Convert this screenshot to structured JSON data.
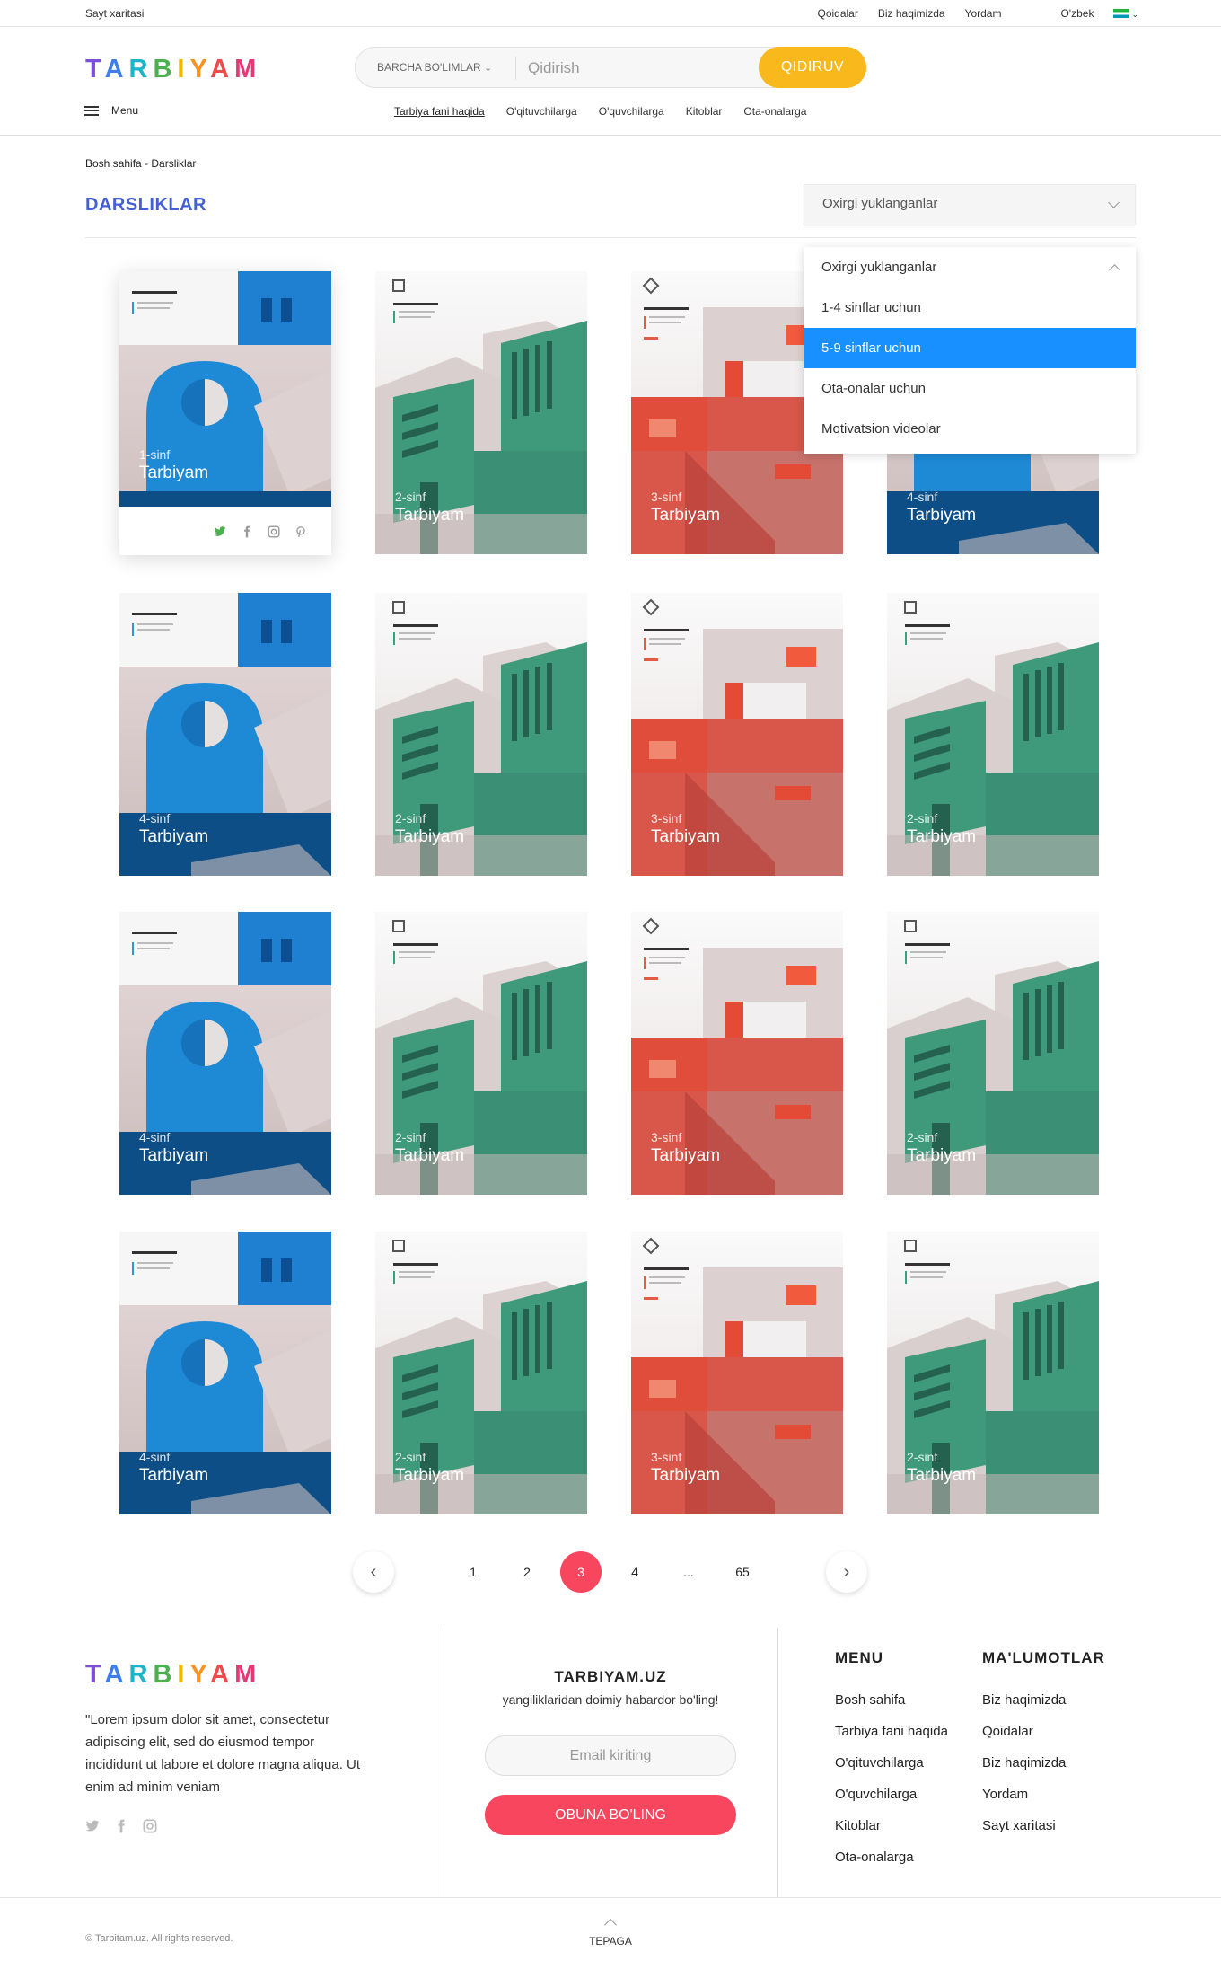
{
  "topbar": {
    "sitemap": "Sayt xaritasi",
    "links": [
      "Qoidalar",
      "Biz haqimizda",
      "Yordam"
    ],
    "language": "O'zbek"
  },
  "brand": {
    "logo_letters": [
      "T",
      "A",
      "R",
      "B",
      "I",
      "Y",
      "A",
      "M"
    ]
  },
  "search": {
    "category": "BARCHA BO'LIMLAR",
    "placeholder": "Qidirish",
    "button": "QIDIRUV"
  },
  "header": {
    "menu_label": "Menu",
    "nav": [
      "Tarbiya fani haqida",
      "O'qituvchilarga",
      "O'quvchilarga",
      "Kitoblar",
      "Ota-onalarga"
    ]
  },
  "page": {
    "breadcrumb": "Bosh sahifa - Darsliklar",
    "title": "DARSLIKLAR"
  },
  "sort": {
    "selected": "Oxirgi yuklanganlar",
    "options": [
      "Oxirgi yuklanganlar",
      "1-4 sinflar uchun",
      "5-9 sinflar uchun",
      "Ota-onalar uchun",
      "Motivatsion videolar"
    ],
    "highlighted": "5-9 sinflar uchun"
  },
  "cards": [
    {
      "grade": "1-sinf",
      "title": "Tarbiyam",
      "style": "blue"
    },
    {
      "grade": "2-sinf",
      "title": "Tarbiyam",
      "style": "green"
    },
    {
      "grade": "3-sinf",
      "title": "Tarbiyam",
      "style": "red"
    },
    {
      "grade": "4-sinf",
      "title": "Tarbiyam",
      "style": "blue"
    },
    {
      "grade": "4-sinf",
      "title": "Tarbiyam",
      "style": "blue"
    },
    {
      "grade": "2-sinf",
      "title": "Tarbiyam",
      "style": "green"
    },
    {
      "grade": "3-sinf",
      "title": "Tarbiyam",
      "style": "red"
    },
    {
      "grade": "2-sinf",
      "title": "Tarbiyam",
      "style": "green"
    },
    {
      "grade": "4-sinf",
      "title": "Tarbiyam",
      "style": "blue"
    },
    {
      "grade": "2-sinf",
      "title": "Tarbiyam",
      "style": "green"
    },
    {
      "grade": "3-sinf",
      "title": "Tarbiyam",
      "style": "red"
    },
    {
      "grade": "2-sinf",
      "title": "Tarbiyam",
      "style": "green"
    },
    {
      "grade": "4-sinf",
      "title": "Tarbiyam",
      "style": "blue"
    },
    {
      "grade": "2-sinf",
      "title": "Tarbiyam",
      "style": "green"
    },
    {
      "grade": "3-sinf",
      "title": "Tarbiyam",
      "style": "red"
    },
    {
      "grade": "2-sinf",
      "title": "Tarbiyam",
      "style": "green"
    }
  ],
  "pagination": {
    "pages": [
      "1",
      "2",
      "3",
      "4",
      "...",
      "65"
    ],
    "current": "3"
  },
  "footer": {
    "about": "\"Lorem ipsum dolor sit amet, consectetur adipiscing elit, sed do eiusmod tempor incididunt ut labore et dolore magna aliqua. Ut enim ad minim veniam",
    "newsletter_title": "TARBIYAM.UZ",
    "newsletter_text": "yangiliklaridan doimiy habardor bo'ling!",
    "email_placeholder": "Email kiriting",
    "subscribe": "OBUNA BO'LING",
    "menu_title": "MENU",
    "menu": [
      "Bosh sahifa",
      "Tarbiya fani haqida",
      "O'qituvchilarga",
      "O'quvchilarga",
      "Kitoblar",
      "Ota-onalarga"
    ],
    "info_title": "MA'LUMOTLAR",
    "info": [
      "Biz haqimizda",
      "Qoidalar",
      "Biz haqimizda",
      "Yordam",
      "Sayt xaritasi"
    ],
    "copyright": "© Tarbitam.uz. All rights reserved.",
    "back_top": "TEPAGA"
  },
  "colors": {
    "accent": "#f9b81c",
    "brand_blue": "#4460d4",
    "pink": "#f8465e",
    "select_blue": "#1890ff"
  }
}
